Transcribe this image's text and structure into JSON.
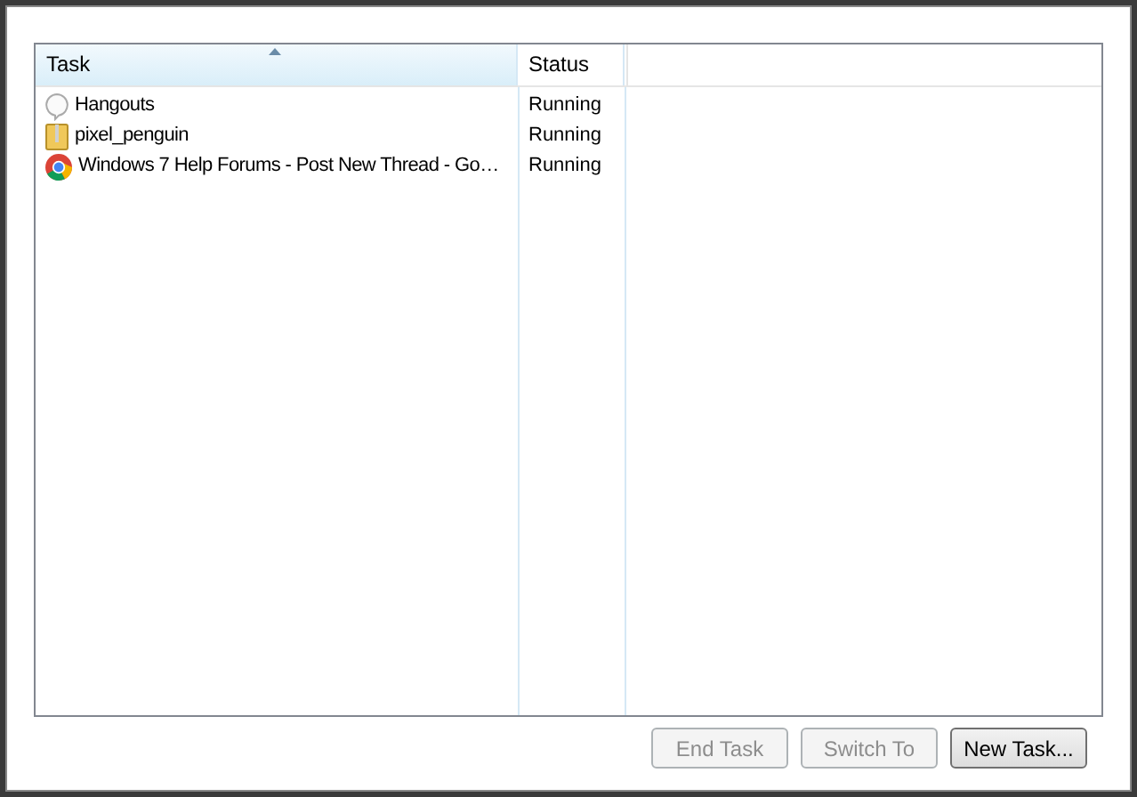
{
  "table": {
    "columns": [
      {
        "label": "Task",
        "sorted": true
      },
      {
        "label": "Status",
        "sorted": false
      }
    ],
    "rows": [
      {
        "kind": "bubble",
        "task": "Hangouts",
        "status": "Running"
      },
      {
        "kind": "folder",
        "task": "pixel_penguin",
        "status": "Running"
      },
      {
        "kind": "browser",
        "task": "Windows 7 Help Forums - Post New Thread - Go…",
        "status": "Running"
      }
    ]
  },
  "buttons": [
    {
      "label": "End Task",
      "disabled": true
    },
    {
      "label": "Switch To",
      "disabled": true
    },
    {
      "label": "New Task...",
      "disabled": false
    }
  ]
}
